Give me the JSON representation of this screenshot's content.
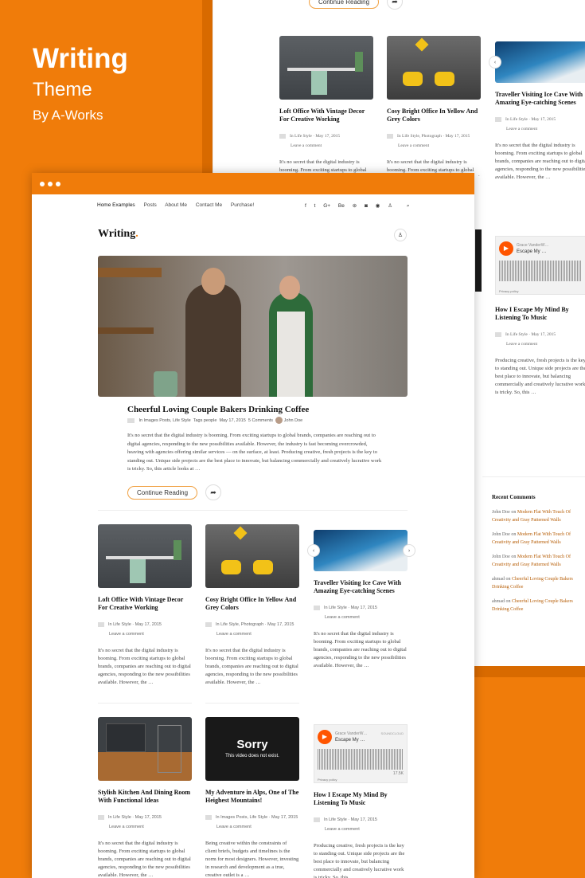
{
  "brand": {
    "title": "Writing",
    "subtitle": "Theme",
    "by": "By A-Works"
  },
  "colors": {
    "accent": "#f07c0a",
    "accent_dark": "#d86a00"
  },
  "nav": {
    "items": [
      "Home Examples",
      "Posts",
      "About Me",
      "Contact Me",
      "Purchase!"
    ]
  },
  "social": [
    "f",
    "t",
    "G+",
    "Be",
    "p",
    "ig",
    "rss",
    "user-icon",
    "search-icon"
  ],
  "logo": {
    "text": "Writing",
    "dot": "."
  },
  "featured": {
    "title": "Cheerful Loving Couple Bakers Drinking Coffee",
    "meta_in": "In",
    "categories": "Images Posts, Life Style",
    "tags_label": "Tags",
    "tags": "people",
    "date": "May 17, 2015",
    "comments": "5 Comments",
    "author": "John Doe",
    "excerpt": "It's no secret that the digital industry is booming. From exciting startups to global brands, companies are reaching out to digital agencies, responding to the new possibilities available. However, the industry is fast becoming overcrowded, heaving with agencies offering similar services — on the surface, at least. Producing creative, fresh projects is the key to standing out. Unique side projects are the best place to innovate, but balancing commercially and creatively lucrative work is tricky. So, this article looks at …",
    "continue": "Continue Reading"
  },
  "cards": [
    {
      "title": "Loft Office With Vintage Decor For Creative Working",
      "cats": "Life Style",
      "date": "May 17, 2015",
      "comment": "Leave a comment",
      "excerpt": "It's no secret that the digital industry is booming. From exciting startups to global brands, companies are reaching out to digital agencies, responding to the new possibilities available. However, the …"
    },
    {
      "title": "Cosy Bright Office In Yellow And Grey Colors",
      "cats": "Life Style, Photograph",
      "date": "May 17, 2015",
      "comment": "Leave a comment",
      "excerpt": "It's no secret that the digital industry is booming. From exciting startups to global brands, companies are reaching out to digital agencies, responding to the new possibilities available. However, the …"
    },
    {
      "title": "Traveller Visiting Ice Cave With Amazing Eye-catching Scenes",
      "cats": "Life Style",
      "date": "May 17, 2015",
      "comment": "Leave a comment",
      "excerpt": "It's no secret that the digital industry is booming. From exciting startups to global brands, companies are reaching out to digital agencies, responding to the new possibilities available. However, the …"
    },
    {
      "title": "Stylish Kitchen And Dining Room With Functional Ideas",
      "cats": "Life Style",
      "date": "May 17, 2015",
      "comment": "Leave a comment",
      "excerpt": "It's no secret that the digital industry is booming. From exciting startups to global brands, companies are reaching out to digital agencies, responding to the new possibilities available. However, the …"
    },
    {
      "title": "My Adventure in Alps, One of The Heighest Mountains!",
      "cats": "Images Posts, Life Style",
      "date": "May 17, 2015",
      "comment": "Leave a comment",
      "excerpt": "Being creative within the constraints of client briefs, budgets and timelines is the norm for most designers. However, investing in research and development as a true, creative outlet is a …"
    },
    {
      "title": "How I Escape My Mind By Listening To Music",
      "cats": "Life Style",
      "date": "May 17, 2015",
      "comment": "Leave a comment",
      "excerpt": "Producing creative, fresh projects is the key to standing out. Unique side projects are the best place to innovate, but balancing commercially and creatively lucrative work is tricky. So, this …"
    }
  ],
  "video": {
    "sorry": "Sorry",
    "msg": "This video does not exist."
  },
  "soundcloud": {
    "artist": "Grace VanderW…",
    "track": "Escape My …",
    "brand": "SOUNDCLOUD",
    "plays": "17.5K",
    "privacy": "Privacy policy"
  },
  "recent": {
    "title": "Recent Comments",
    "items": [
      {
        "author": "John Doe",
        "on": "on",
        "post": "Modern Flat With Touch Of Creativity and Gray Patterned Walls"
      },
      {
        "author": "John Doe",
        "on": "on",
        "post": "Modern Flat With Touch Of Creativity and Gray Patterned Walls"
      },
      {
        "author": "John Doe",
        "on": "on",
        "post": "Modern Flat With Touch Of Creativity and Gray Patterned Walls"
      },
      {
        "author": "ahmad",
        "on": "on",
        "post": "Cheerful Loving Couple Bakers Drinking Coffee"
      },
      {
        "author": "ahmad",
        "on": "on",
        "post": "Cheerful Loving Couple Bakers Drinking Coffee"
      }
    ]
  }
}
